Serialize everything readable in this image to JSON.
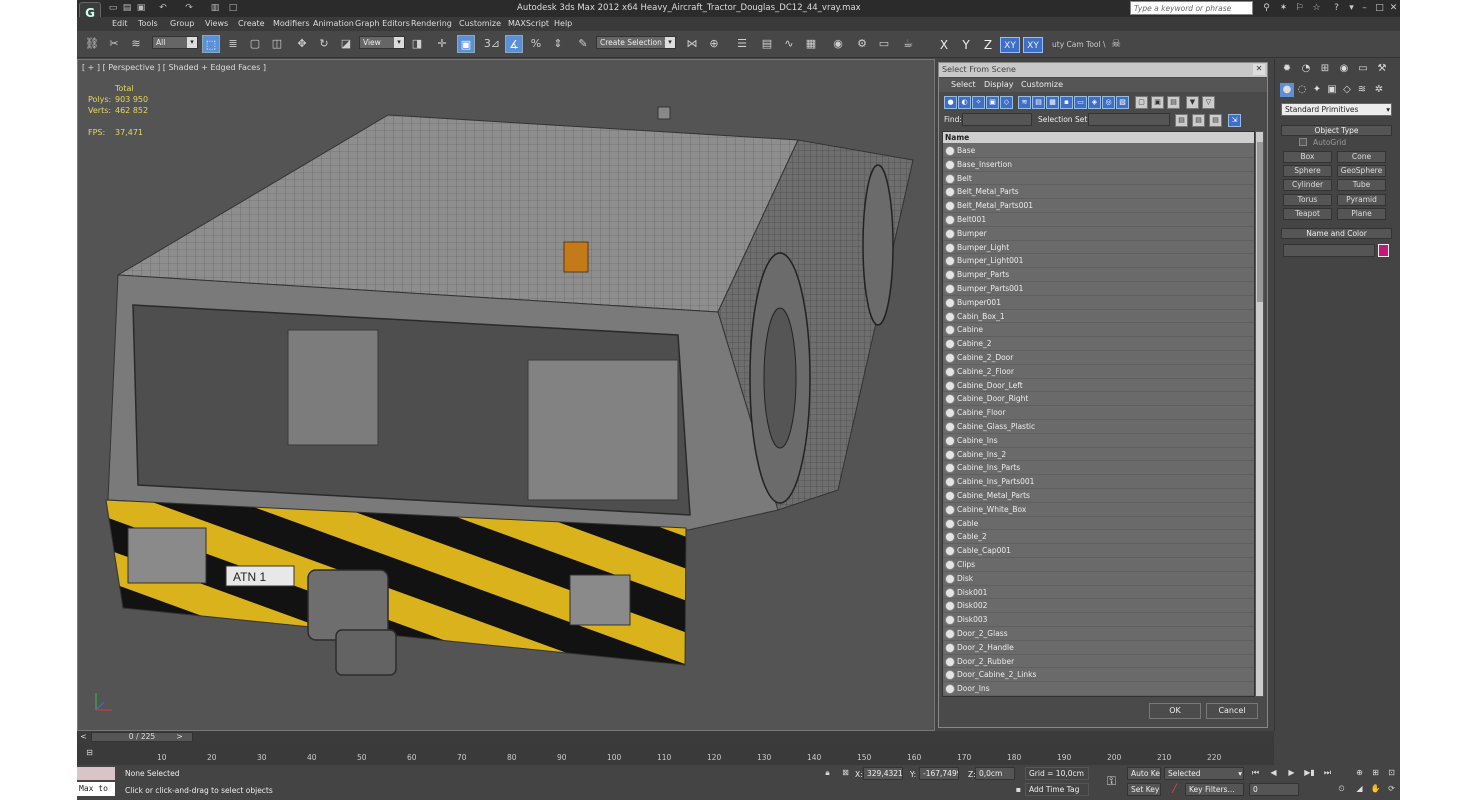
{
  "window": {
    "title": "Autodesk 3ds Max  2012 x64     Heavy_Aircraft_Tractor_Douglas_DC12_44_vray.max",
    "search_placeholder": "Type a keyword or phrase"
  },
  "menu": [
    "Edit",
    "Tools",
    "Group",
    "Views",
    "Create",
    "Modifiers",
    "Animation",
    "Graph Editors",
    "Rendering",
    "Customize",
    "MAXScript",
    "Help"
  ],
  "toolbar": {
    "selection_filter": "All",
    "ref_coord": "View",
    "named_selection": "Create Selection Se",
    "snap_label": "3",
    "axes": [
      "X",
      "Y",
      "Z",
      "XY",
      "XY"
    ],
    "tool_label": "uty Cam Tool \\"
  },
  "viewport": {
    "label": "[ + ] [ Perspective ] [ Shaded + Edged Faces ]",
    "stats": {
      "total_label": "Total",
      "polys_label": "Polys:",
      "polys": "903 950",
      "verts_label": "Verts:",
      "verts": "462 852",
      "fps_label": "FPS:",
      "fps": "37,471"
    },
    "plate_text": "ATN 1"
  },
  "dialog": {
    "title": "Select From Scene",
    "menu": [
      "Select",
      "Display",
      "Customize"
    ],
    "find_label": "Find:",
    "selset_label": "Selection Set:",
    "column_header": "Name",
    "items": [
      "Base",
      "Base_Insertion",
      "Belt",
      "Belt_Metal_Parts",
      "Belt_Metal_Parts001",
      "Belt001",
      "Bumper",
      "Bumper_Light",
      "Bumper_Light001",
      "Bumper_Parts",
      "Bumper_Parts001",
      "Bumper001",
      "Cabin_Box_1",
      "Cabine",
      "Cabine_2",
      "Cabine_2_Door",
      "Cabine_2_Floor",
      "Cabine_Door_Left",
      "Cabine_Door_Right",
      "Cabine_Floor",
      "Cabine_Glass_Plastic",
      "Cabine_Ins",
      "Cabine_Ins_2",
      "Cabine_Ins_Parts",
      "Cabine_Ins_Parts001",
      "Cabine_Metal_Parts",
      "Cabine_White_Box",
      "Cable",
      "Cable_2",
      "Cable_Cap001",
      "Clips",
      "Disk",
      "Disk001",
      "Disk002",
      "Disk003",
      "Door_2_Glass",
      "Door_2_Handle",
      "Door_2_Rubber",
      "Door_Cabine_2_Links",
      "Door_Ins"
    ],
    "ok": "OK",
    "cancel": "Cancel"
  },
  "command_panel": {
    "dropdown": "Standard Primitives",
    "object_type": "Object Type",
    "autogrid": "AutoGrid",
    "buttons": [
      "Box",
      "Cone",
      "Sphere",
      "GeoSphere",
      "Cylinder",
      "Tube",
      "Torus",
      "Pyramid",
      "Teapot",
      "Plane"
    ],
    "name_color": "Name and Color",
    "color": "#c2187a"
  },
  "timeline": {
    "frame": "0 / 225",
    "ticks": [
      "10",
      "20",
      "30",
      "40",
      "50",
      "60",
      "70",
      "80",
      "90",
      "100",
      "110",
      "120",
      "130",
      "140",
      "150",
      "160",
      "170",
      "180",
      "190",
      "200",
      "210",
      "220"
    ]
  },
  "status": {
    "maxscript": "Max to",
    "selection": "None Selected",
    "prompt": "Click or click-and-drag to select objects",
    "x_label": "X:",
    "x": "329,4321c",
    "y_label": "Y:",
    "y": "-167,7499c",
    "z_label": "Z:",
    "z": "0,0cm",
    "grid": "Grid = 10,0cm",
    "add_time_tag": "Add Time Tag",
    "auto_key": "Auto Key",
    "set_key": "Set Key",
    "key_mode": "Selected",
    "key_filters": "Key Filters...",
    "frame_field": "0"
  }
}
